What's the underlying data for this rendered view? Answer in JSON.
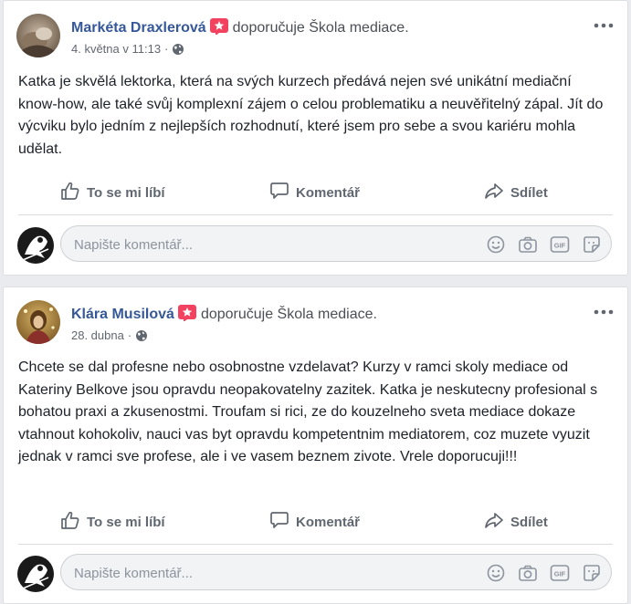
{
  "colors": {
    "author_link": "#365899",
    "badge": "#f3425f",
    "text": "#1d2129",
    "secondary": "#616770",
    "action": "#606770"
  },
  "posts": [
    {
      "author": "Markéta Draxlerová",
      "badge_icon": "recommend-star-icon",
      "recommends": "doporučuje Škola mediace.",
      "date": "4. května v 11:13",
      "separator": "·",
      "privacy_icon": "globe-icon",
      "text": "Katka je skvělá lektorka, která na svých kurzech předává nejen své unikátní mediační know-how, ale také svůj komplexní zájem o celou problematiku a neuvěřitelný zápal. Jít do výcviku bylo jedním z nejlepších rozhodnutí, které jsem pro sebe a svou kariéru mohla udělat.",
      "actions": {
        "like": "To se mi líbí",
        "comment": "Komentář",
        "share": "Sdílet"
      },
      "comment_placeholder": "Napište komentář..."
    },
    {
      "author": "Klára Musilová",
      "badge_icon": "recommend-star-icon",
      "recommends": "doporučuje Škola mediace.",
      "date": "28. dubna",
      "separator": "·",
      "privacy_icon": "globe-icon",
      "text": "Chcete se dal profesne nebo osobnostne vzdelavat? Kurzy v ramci skoly mediace od Kateriny Belkove jsou opravdu neopakovatelny zazitek. Katka je neskutecny profesional s bohatou praxi a zkusenostmi. Troufam si rici, ze do kouzelneho sveta mediace dokaze vtahnout kohokoliv, nauci vas byt opravdu kompetentnim mediatorem, coz muzete vyuzit jednak v ramci sve profese, ale i ve vasem beznem zivote. Vrele doporucuji!!!",
      "actions": {
        "like": "To se mi líbí",
        "comment": "Komentář",
        "share": "Sdílet"
      },
      "comment_placeholder": "Napište komentář..."
    }
  ],
  "composer_icons": [
    "emoji-icon",
    "camera-icon",
    "gif-icon",
    "sticker-icon"
  ],
  "composer_icon_labels": {
    "gif": "GIF"
  }
}
